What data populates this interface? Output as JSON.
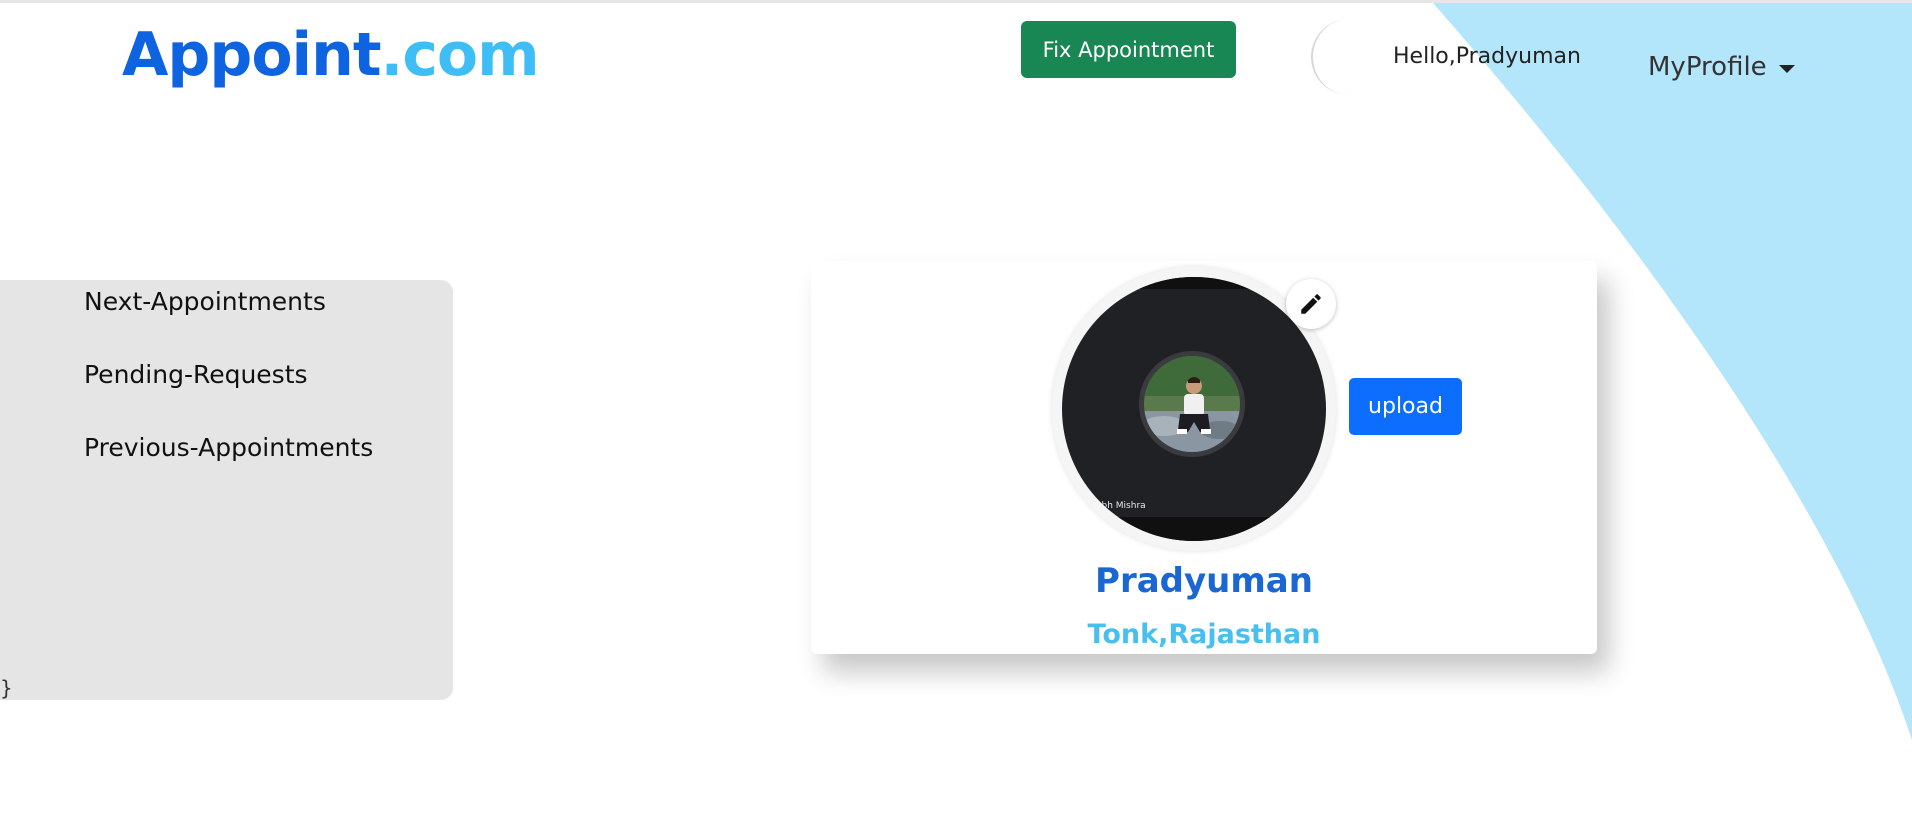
{
  "header": {
    "brand_main": "Appoint",
    "brand_suffix": ".com",
    "fix_appointment_label": "Fix Appointment",
    "greeting": "Hello,Pradyuman",
    "profile_menu_label": "MyProfile"
  },
  "sidebar": {
    "items": [
      {
        "label": "Next-Appointments"
      },
      {
        "label": "Pending-Requests"
      },
      {
        "label": "Previous-Appointments"
      }
    ],
    "stray_text": "}"
  },
  "profile_card": {
    "photo_caption": "abh Mishra",
    "upload_label": "upload",
    "name": "Pradyuman",
    "location": "Tonk,Rajasthan"
  },
  "colors": {
    "brand_blue": "#0d63e0",
    "brand_light_blue": "#3fbef5",
    "success_green": "#198754",
    "primary_blue": "#0d6efd",
    "wave_blue": "#b4e6fb",
    "sidebar_gray": "#e5e5e5"
  },
  "icons": {
    "edit": "pencil-icon",
    "menu_caret": "caret-down-icon"
  }
}
